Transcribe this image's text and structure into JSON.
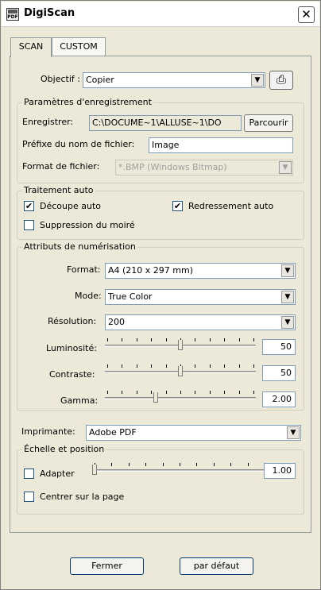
{
  "window": {
    "title": "DigiScan",
    "close_glyph": "✕"
  },
  "tabs": [
    {
      "label": "SCAN"
    },
    {
      "label": "CUSTOM"
    }
  ],
  "objectif": {
    "label": "Objectif :",
    "value": "Copier"
  },
  "enregistrement": {
    "title": "Paramètres d'enregistrement",
    "save_label": "Enregistrer:",
    "save_path": "C:\\DOCUME~1\\ALLUSE~1\\DO",
    "browse_label": "Parcourir",
    "prefix_label": "Préfixe du nom de fichier:",
    "prefix_value": "Image",
    "format_label": "Format de fichier:",
    "format_value": "*.BMP (Windows Bitmap)"
  },
  "traitement": {
    "title": "Traitement auto",
    "decoupe_label": "Découpe auto",
    "decoupe_checked": true,
    "redressement_label": "Redressement auto",
    "redressement_checked": true,
    "moire_label": "Suppression du moiré",
    "moire_checked": false
  },
  "attributs": {
    "title": "Attributs de numérisation",
    "format_label": "Format:",
    "format_value": "A4 (210 x 297 mm)",
    "mode_label": "Mode:",
    "mode_value": "True Color",
    "resolution_label": "Résolution:",
    "resolution_value": "200",
    "luminosite_label": "Luminosité:",
    "luminosite_value": "50",
    "luminosite_level": 0.5,
    "contraste_label": "Contraste:",
    "contraste_value": "50",
    "contraste_level": 0.5,
    "gamma_label": "Gamma:",
    "gamma_value": "2.00",
    "gamma_level": 0.33
  },
  "imprimante": {
    "label": "Imprimante:",
    "value": "Adobe PDF"
  },
  "echelle": {
    "title": "Échelle et position",
    "adapter_label": "Adapter",
    "adapter_checked": false,
    "adapter_value": "1.00",
    "adapter_level": 0.0,
    "centrer_label": "Centrer sur la page",
    "centrer_checked": false
  },
  "footer": {
    "close_label": "Fermer",
    "default_label": "par défaut"
  },
  "icons": {
    "dropdown_arrow": "▼",
    "check_mark": "✔",
    "scanner_glyph": "⎙"
  }
}
